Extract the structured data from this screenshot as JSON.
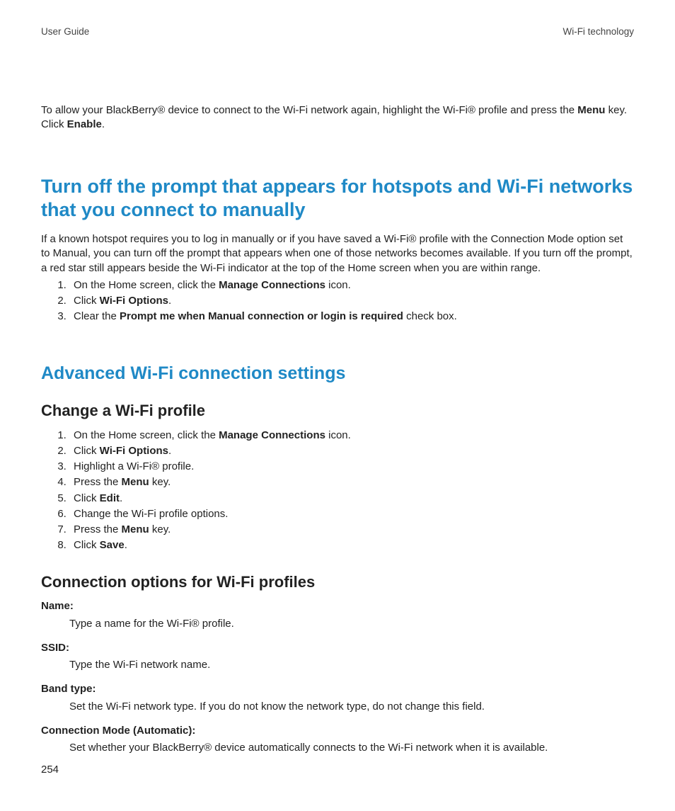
{
  "header": {
    "left": "User Guide",
    "right": "Wi-Fi technology"
  },
  "intro": {
    "pre": "To allow your BlackBerry® device to connect to the Wi-Fi network again, highlight the Wi-Fi® profile and press the ",
    "b1": "Menu",
    "mid": " key. Click ",
    "b2": "Enable",
    "post": "."
  },
  "h1": "Turn off the prompt that appears for hotspots and Wi-Fi networks that you connect to manually",
  "p1": "If a known hotspot requires you to log in manually or if you have saved a Wi-Fi® profile with the Connection Mode option set to Manual, you can turn off the prompt that appears when one of those networks becomes available. If you turn off the prompt, a red star still appears beside the Wi-Fi indicator at the top of the Home screen when you are within range.",
  "stepsA": {
    "s1a": "On the Home screen, click the ",
    "s1b": "Manage Connections",
    "s1c": " icon.",
    "s2a": "Click ",
    "s2b": "Wi-Fi Options",
    "s2c": ".",
    "s3a": "Clear the ",
    "s3b": "Prompt me when Manual connection or login is required",
    "s3c": " check box."
  },
  "h2": "Advanced Wi-Fi connection settings",
  "h3": "Change a Wi-Fi profile",
  "stepsB": {
    "s1a": "On the Home screen, click the ",
    "s1b": "Manage Connections",
    "s1c": " icon.",
    "s2a": "Click ",
    "s2b": "Wi-Fi Options",
    "s2c": ".",
    "s3": "Highlight a Wi-Fi® profile.",
    "s4a": "Press the ",
    "s4b": "Menu",
    "s4c": " key.",
    "s5a": "Click ",
    "s5b": "Edit",
    "s5c": ".",
    "s6": "Change the Wi-Fi profile options.",
    "s7a": "Press the ",
    "s7b": "Menu",
    "s7c": " key.",
    "s8a": "Click ",
    "s8b": "Save",
    "s8c": "."
  },
  "h4": "Connection options for Wi-Fi profiles",
  "opts": {
    "name_t": "Name:",
    "name_d": "Type a name for the Wi-Fi® profile.",
    "ssid_t": "SSID:",
    "ssid_d": "Type the Wi-Fi network name.",
    "band_t": "Band type:",
    "band_d": "Set the Wi-Fi network type. If you do not know the network type, do not change this field.",
    "conn_t": "Connection Mode (Automatic):",
    "conn_d": "Set whether your BlackBerry® device automatically connects to the Wi-Fi network when it is available."
  },
  "pagenum": "254"
}
